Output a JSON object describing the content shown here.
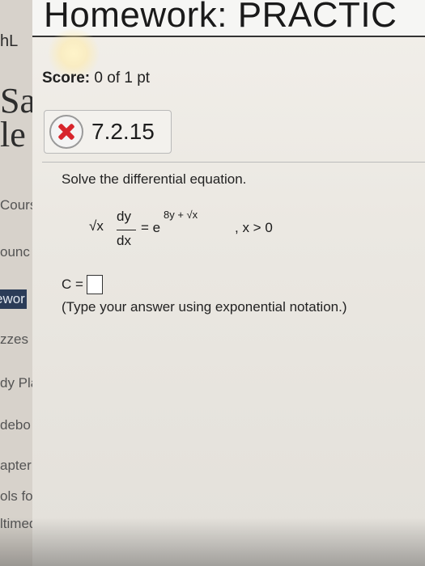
{
  "header": {
    "title": "Homework: PRACTIC"
  },
  "sidebar": {
    "top_text": "hL",
    "big_text": "Sa\nle",
    "items": [
      {
        "label": "Cours"
      },
      {
        "label": "ounc"
      },
      {
        "label": "ewor"
      },
      {
        "label": "zzes"
      },
      {
        "label": "dy Pla"
      },
      {
        "label": "debo"
      },
      {
        "label": "apter"
      },
      {
        "label": "ols for"
      },
      {
        "label": "ltimed"
      }
    ]
  },
  "score": {
    "label": "Score:",
    "value": "0 of 1 pt"
  },
  "question": {
    "id": "7.2.15",
    "status_icon": "incorrect-x-icon",
    "prompt": "Solve the differential equation.",
    "equation": {
      "radical": "√x",
      "num": "dy",
      "den": "dx",
      "equals": "= e",
      "exponent": "8y + √x",
      "condition": ", x > 0"
    },
    "answer_label": "C =",
    "hint": "(Type your answer using exponential notation.)"
  }
}
